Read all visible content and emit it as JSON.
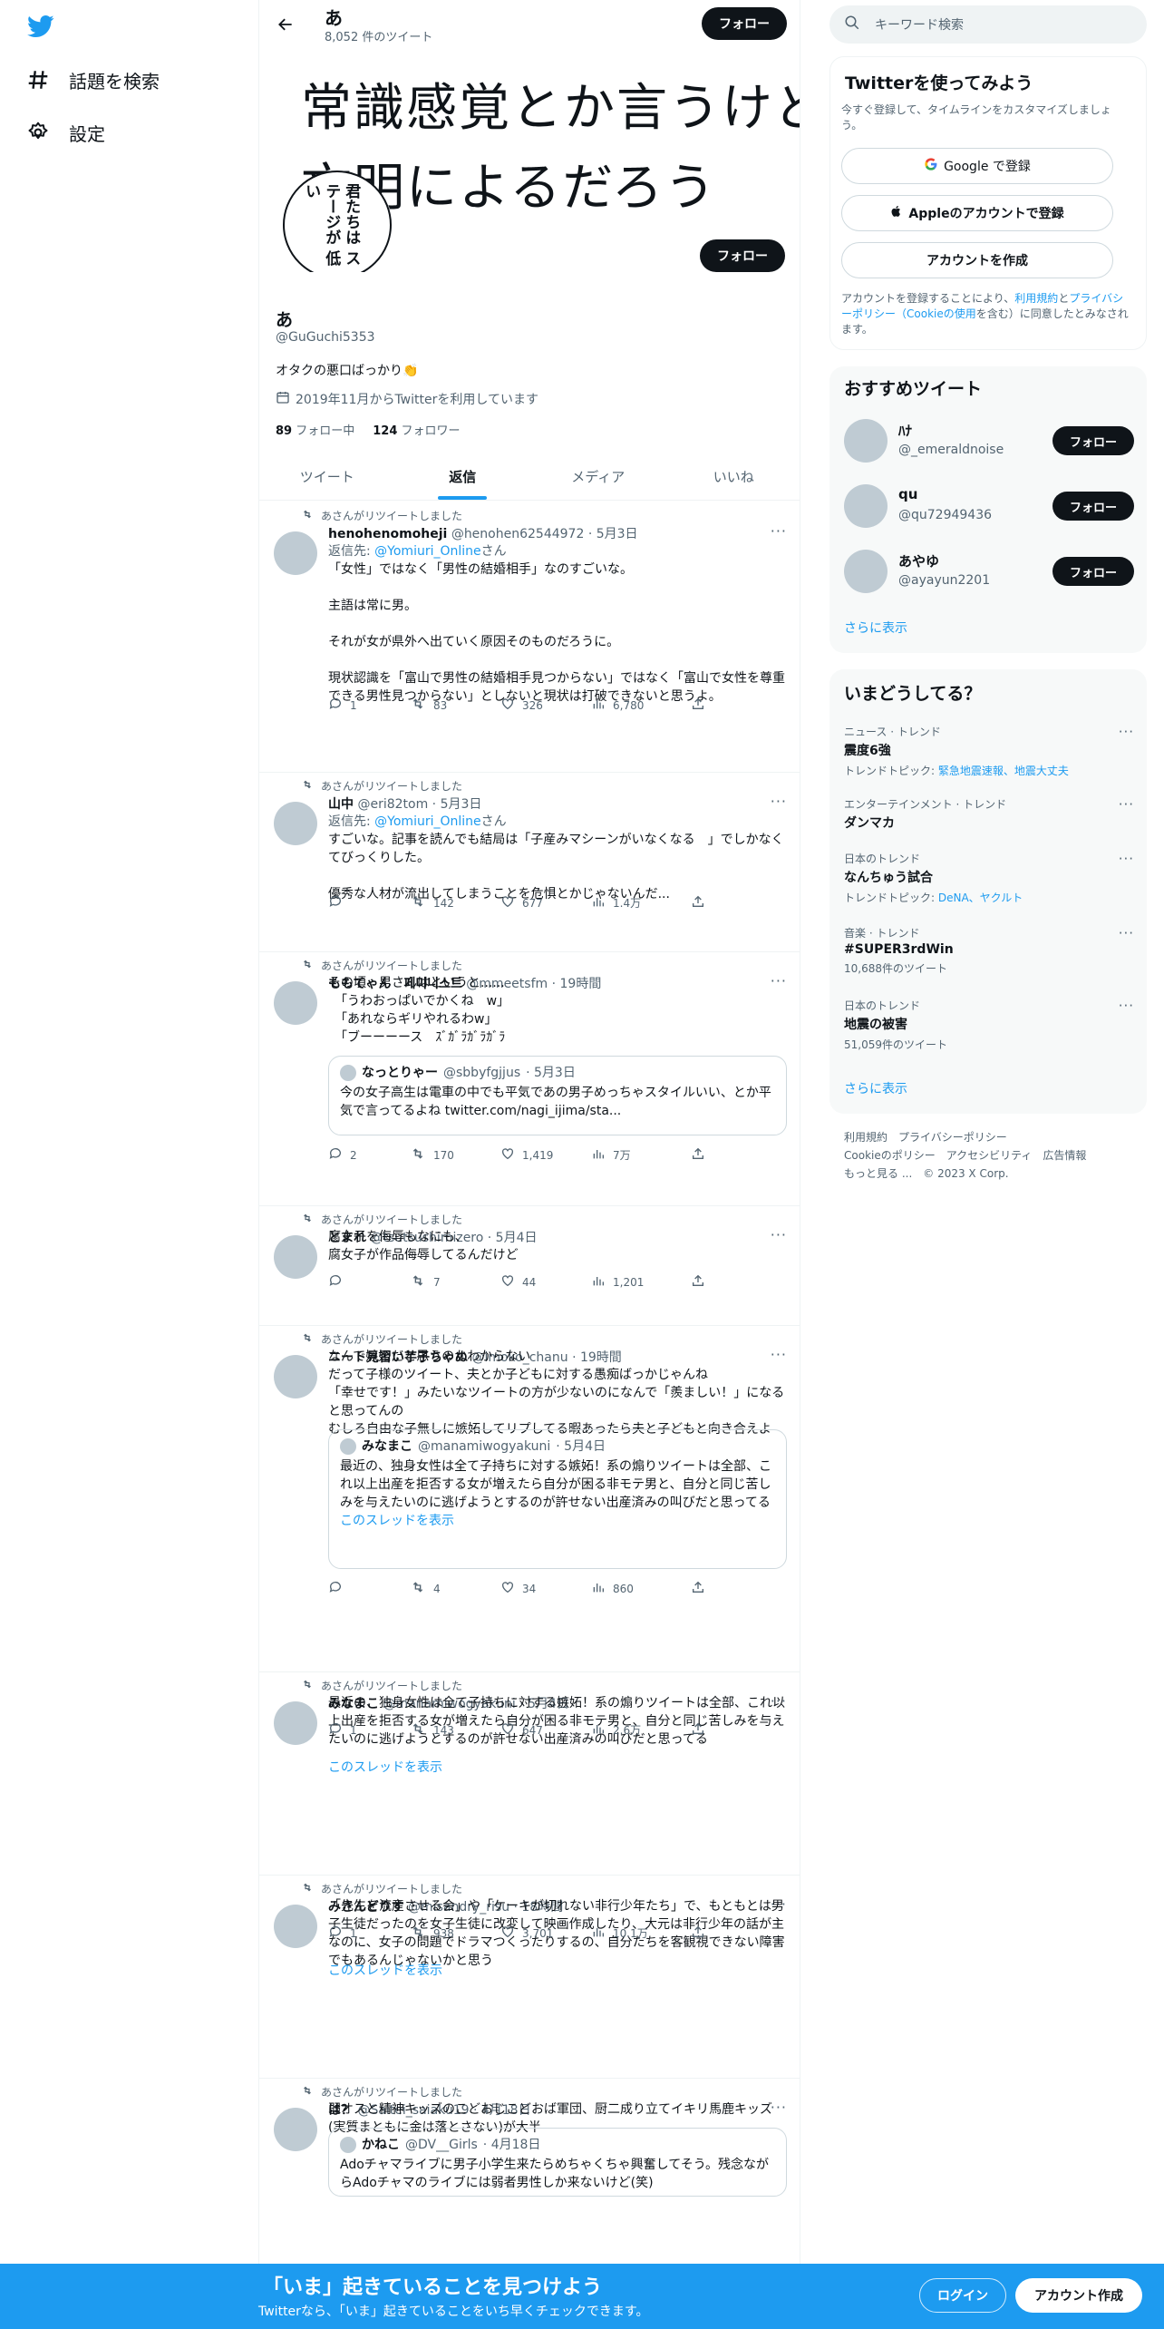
{
  "nav": {
    "explore": "話題を検索",
    "settings": "設定"
  },
  "header": {
    "name": "あ",
    "tweet_count": "8,052 件のツイート",
    "follow": "フォロー"
  },
  "banner": {
    "line1": "常識感覚とか言うけど",
    "line2": "文明によるだろう",
    "bubble": "君たちは ステージが 低い"
  },
  "profile": {
    "follow": "フォロー",
    "name": "あ",
    "handle": "@GuGuchi5353",
    "bio": "オタクの悪口ばっかり👏",
    "joined": "2019年11月からTwitterを利用しています",
    "following_n": "89",
    "following_label": "フォロー中",
    "followers_n": "124",
    "followers_label": "フォロワー"
  },
  "tabs": [
    "ツイート",
    "返信",
    "メディア",
    "いいね"
  ],
  "tweets": [
    {
      "rt": "あさんがリツイートしました",
      "name": "henohenomoheji",
      "handle": "@henohen62544972",
      "date": "· 5月3日",
      "reply_prefix": "返信先: ",
      "reply_to": "@Yomiuri_Online",
      "reply_suffix": "さん",
      "lines": [
        "「女性」ではなく「男性の結婚相手」なのすごいな。",
        "",
        "主語は常に男。",
        "",
        "それが女が県外へ出ていく原因そのものだろうに。",
        "",
        "現状認識を「富山で男性の結婚相手見つからない」ではなく「富山で女性を尊重できる男性見つからない」としないと現状は打破できないと思うよ。"
      ],
      "reply": "1",
      "retweet": "83",
      "like": "326",
      "views": "6,780"
    },
    {
      "rt": "あさんがリツイートしました",
      "name": "山中",
      "handle": "@eri82tom",
      "date": "· 5月3日",
      "reply_prefix": "返信先: ",
      "reply_to": "@Yomiuri_Online",
      "reply_suffix": "さん",
      "lines": [
        "すごいな。記事を読んでも結局は「子産みマシーンがいなくなる　」でしかなくてびっくりした。",
        "",
        "優秀な人材が流出してしまうことを危惧とかじゃないんだ..."
      ],
      "reply": "",
      "retweet": "142",
      "like": "677",
      "views": "1.4万"
    },
    {
      "rt": "あさんがリツイートしました",
      "name": "ももてゃん　페미니스트",
      "handle": "@mmeetsfm",
      "date": "· 19時間",
      "lines": [
        "その頃、男さんはというと......",
        "　「うわおっぱいでかくね　w」",
        "　「あれならギリやれるわw」",
        "　「ブーーーース　ｽﾞｶﾞﾗｶﾞﾗｶﾞﾗ"
      ],
      "quote": {
        "name": "なっとりゃー",
        "handle": "@sbbyfgjjus",
        "date": "· 5月3日",
        "text": "今の女子高生は電車の中でも平気であの男子めっちゃスタイルいい、とか平気で言ってるよね twitter.com/nagi_ijima/sta..."
      },
      "reply": "2",
      "retweet": "170",
      "like": "1,419",
      "views": "7万"
    },
    {
      "rt": "あさんがリツイートしました",
      "name": "とまれ",
      "handle": "@tsutsushimizero",
      "date": "· 5月4日",
      "lines": [
        "腐女子を侮辱もなにも、",
        "腐女子が作品侮辱してるんだけど"
      ],
      "reply": "",
      "retweet": "7",
      "like": "44",
      "views": "1,201"
    },
    {
      "rt": "あさんがリツイートしました",
      "name": "ニート見習い芋子ちゃぬ",
      "handle": "@imoko_chanu",
      "date": "· 19時間",
      "lines": [
        "なんで嫉妬だと思うのかわからない",
        "だって子様のツイート、夫とか子どもに対する愚痴ばっかじゃんね",
        "「幸せです！」みたいなツイートの方が少ないのになんで「羨ましい！」になると思ってんの",
        "むしろ自由な子無しに嫉妬してリプしてる暇あったら夫と子どもと向き合えよ"
      ],
      "quote": {
        "name": "みなまこ",
        "handle": "@manamiwogyakuni",
        "date": "· 5月4日",
        "text": "最近の、独身女性は全て子持ちに対する嫉妬！系の煽りツイートは全部、これ以上出産を拒否する女が増えたら自分が困る非モテ男と、自分と同じ苦しみを与えたいのに逃げようとするのが許せない出産済みの叫びだと思ってる",
        "thread": "このスレッドを表示"
      },
      "reply": "",
      "retweet": "4",
      "like": "34",
      "views": "860"
    },
    {
      "rt": "あさんがリツイートしました",
      "name": "みなまこ",
      "handle": "@manamiwogyakuni",
      "date": "· 5月4日",
      "lines": [
        "最近の、独身女性は全て子持ちに対する嫉妬！系の煽りツイートは全部、これ以上出産を拒否する女が増えたら自分が困る非モテ男と、自分と同じ苦しみを与えたいのに逃げようとするのが許せない出産済みの叫びだと思ってる"
      ],
      "reply": "1",
      "retweet": "143",
      "like": "647",
      "views": "2.6万",
      "thread": "このスレッドを表示"
    },
    {
      "rt": "あさんがリツイートしました",
      "name": "みさんどりす",
      "handle": "@misandry_risu",
      "date": "· 18時間",
      "lines": [
        "「先生を流産させる会」や「ケーキが切れない非行少年たち」で、もともとは男子生徒だったのを女子生徒に改変して映画作成したり、大元は非行少年の話が主なのに、女子の問題でドラマつくったりするの、自分たちを客観視できない障害でもあるんじゃないかと思う"
      ],
      "reply": "1",
      "retweet": "938",
      "like": "3,701",
      "views": "10.1万",
      "thread": "このスレッドを表示"
    },
    {
      "rt": "あさんがリツイートしました",
      "name": "は？",
      "handle": "@Saitei_saiaku19",
      "date": "· 4月18日",
      "lines": [
        "弱オスと精神キッズのこどおじこどおば軍団、厨二成り立てイキリ馬鹿キッズ(実質まともに金は落とさない)が大半"
      ],
      "quote": {
        "name": "かねこ",
        "handle": "@DV__Girls",
        "date": "· 4月18日",
        "text": "Adoチャマライブに男子小学生来たらめちゃくちゃ興奮してそう。残念ながらAdoチャマのライブには弱者男性しか来ないけど(笑)"
      }
    }
  ],
  "right": {
    "search_placeholder": "キーワード検索",
    "signup": {
      "title": "Twitterを使ってみよう",
      "sub": "今すぐ登録して、タイムラインをカスタマイズしましょう。",
      "google": "Google で登録",
      "apple": "Appleのアカウントで登録",
      "create": "アカウントを作成",
      "legal_a": "アカウントを登録することにより、",
      "legal_terms": "利用規約",
      "legal_and": "と",
      "legal_privacy": "プライバシーポリシー（Cookieの使用",
      "legal_b": "を含む）に同意したとみなされます。"
    },
    "recommend": {
      "title": "おすすめツイート",
      "users": [
        {
          "name": "ﾊﾅ",
          "handle": "@_emeraldnoise"
        },
        {
          "name": "qu",
          "handle": "@qu72949436"
        },
        {
          "name": "あやゆ",
          "handle": "@ayayun2201"
        }
      ],
      "follow": "フォロー",
      "more": "さらに表示"
    },
    "trends": {
      "title": "いまどうしてる？",
      "items": [
        {
          "cat": "ニュース · トレンド",
          "name": "震度6強",
          "sub_label": "トレンドトピック: ",
          "sub_link": "緊急地震速報、地震大丈夫"
        },
        {
          "cat": "エンターテインメント · トレンド",
          "name": "ダンマカ"
        },
        {
          "cat": "日本のトレンド",
          "name": "なんちゅう試合",
          "sub_label": "トレンドトピック: ",
          "sub_link": "DeNA、ヤクルト"
        },
        {
          "cat": "音楽 · トレンド",
          "name": "#SUPER3rdWin",
          "sub_plain": "10,688件のツイート"
        },
        {
          "cat": "日本のトレンド",
          "name": "地震の被害",
          "sub_plain": "51,059件のツイート"
        }
      ],
      "more": "さらに表示"
    },
    "footer": [
      "利用規約",
      "プライバシーポリシー",
      "Cookieのポリシー",
      "アクセシビリティ",
      "広告情報",
      "もっと見る ...",
      "© 2023 X Corp."
    ]
  },
  "bottom": {
    "title": "「いま」起きていることを見つけよう",
    "sub": "Twitterなら、「いま」起きていることをいち早くチェックできます。",
    "login": "ログイン",
    "signup": "アカウント作成"
  }
}
